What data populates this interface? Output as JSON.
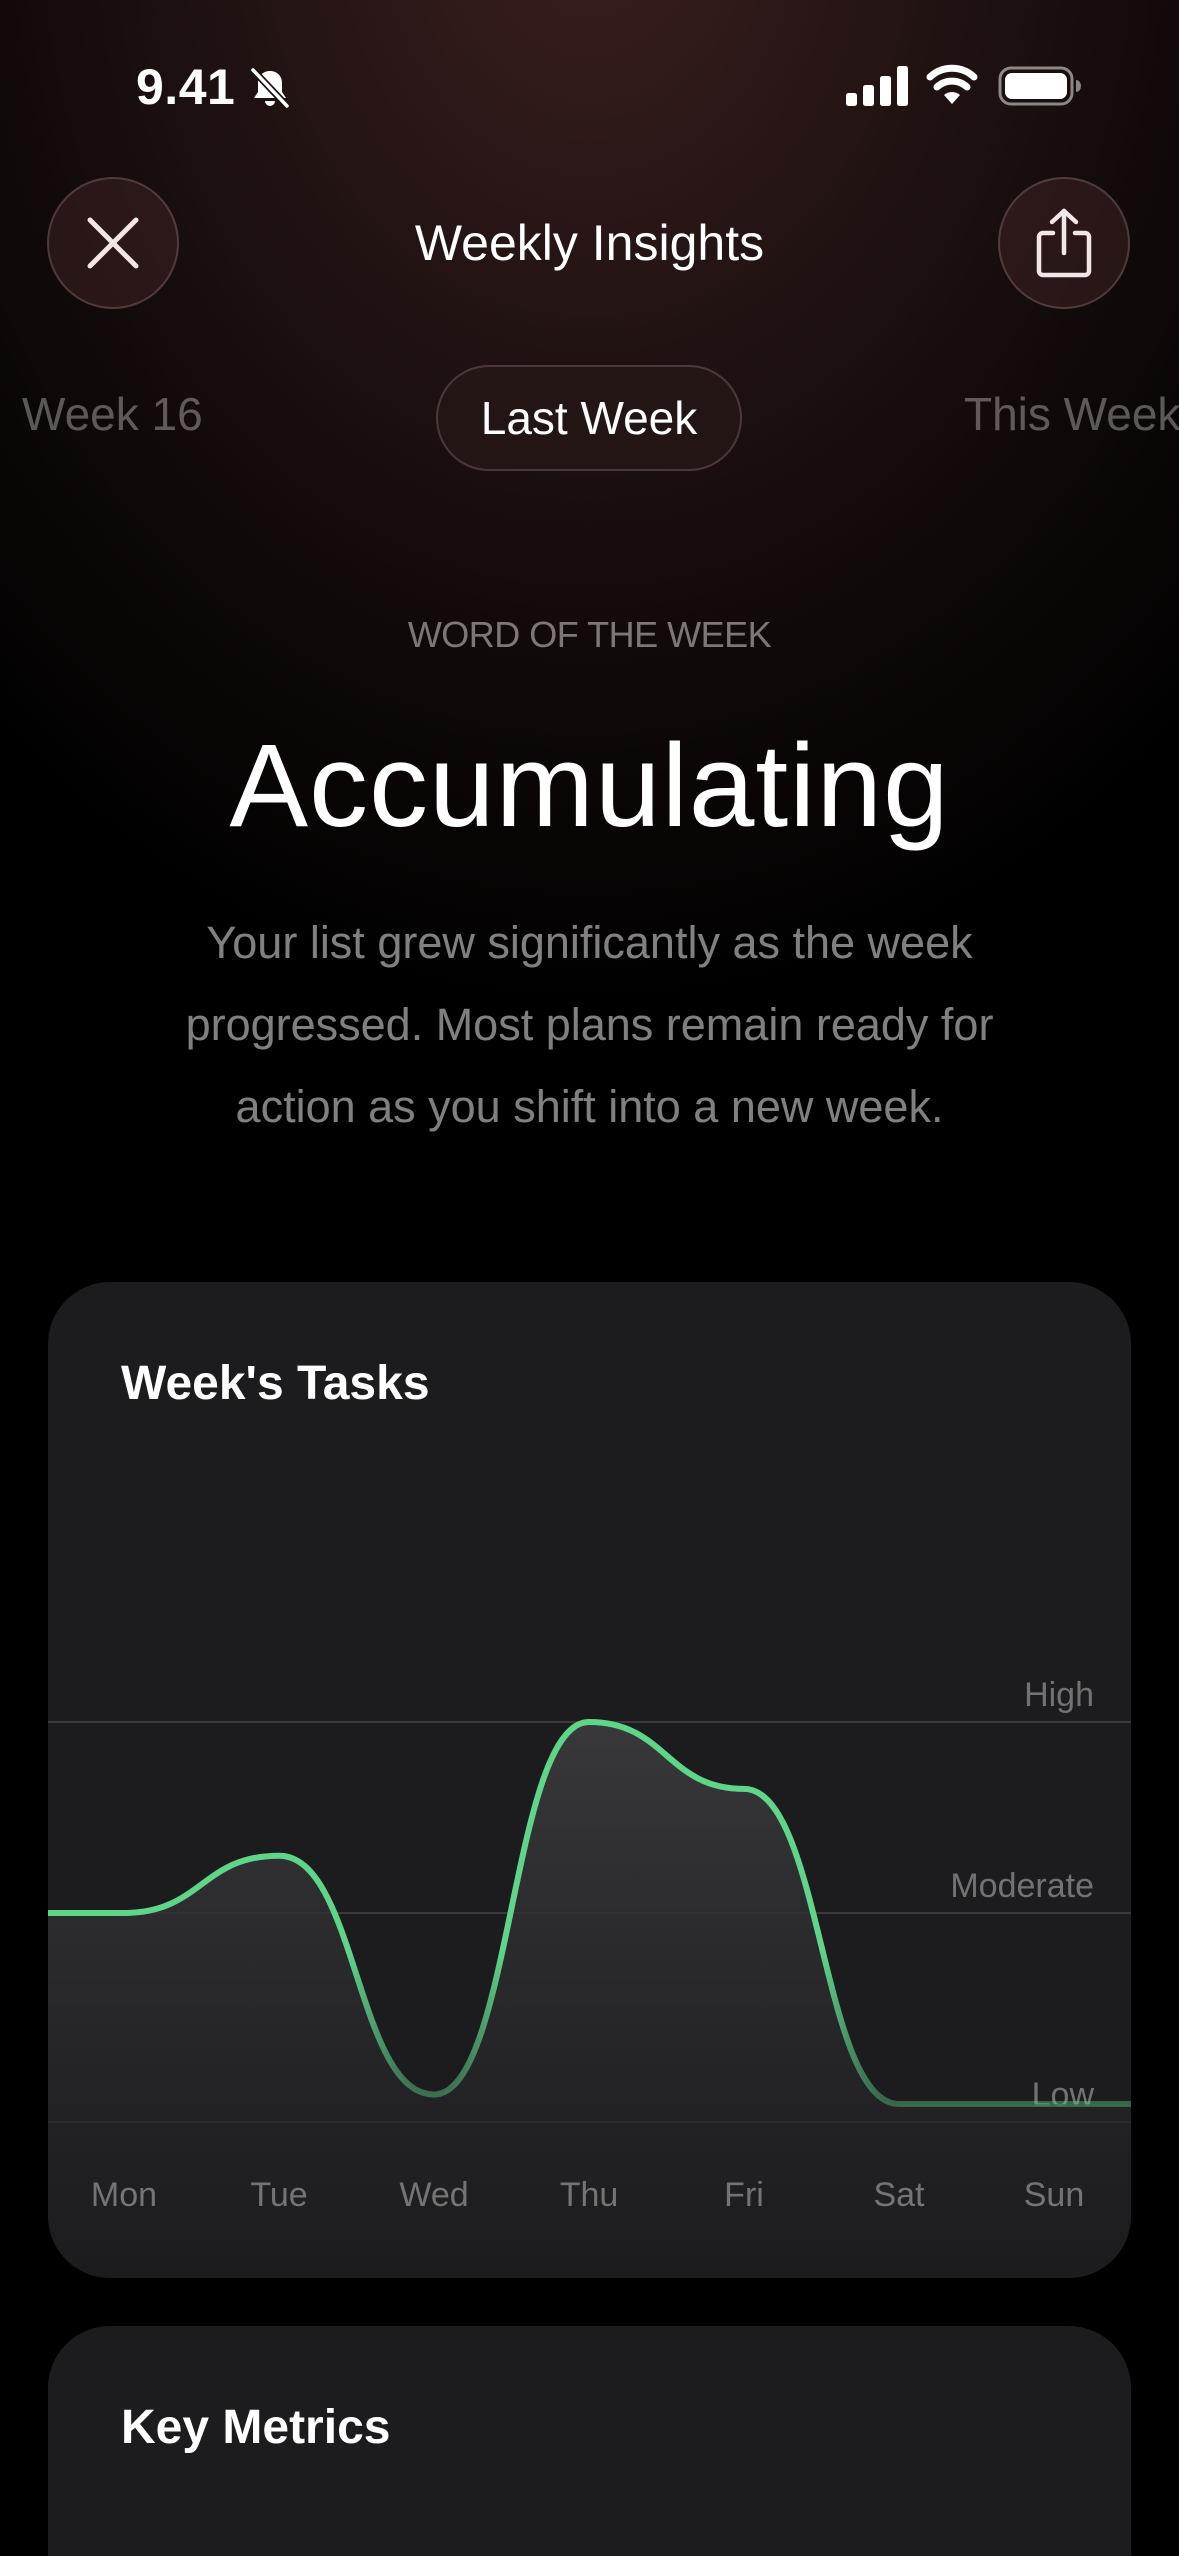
{
  "status_bar": {
    "time": "9.41",
    "icons": [
      "bell-slash-icon",
      "cellular-signal-icon",
      "wifi-icon",
      "battery-icon"
    ]
  },
  "header": {
    "title": "Weekly Insights",
    "close_icon": "close-icon",
    "share_icon": "share-icon"
  },
  "week_selector": {
    "previous": "Week 16",
    "current": "Last Week",
    "next": "This Week"
  },
  "word_of_week": {
    "label": "WORD OF THE WEEK",
    "word": "Accumulating",
    "description": "Your list grew significantly as the week progressed. Most plans remain ready for action as you shift into a new week."
  },
  "tasks_card": {
    "title": "Week's Tasks"
  },
  "chart_data": {
    "type": "area",
    "title": "Week's Tasks",
    "categories": [
      "Mon",
      "Tue",
      "Wed",
      "Thu",
      "Fri",
      "Sat",
      "Sun"
    ],
    "y_levels": [
      "Low",
      "Moderate",
      "High"
    ],
    "y_level_values": [
      0,
      1,
      2
    ],
    "series": [
      {
        "values": [
          1.0,
          1.3,
          0.05,
          2.0,
          1.65,
          0.0,
          0.0
        ]
      }
    ],
    "ylim": [
      0,
      2
    ],
    "grid": true,
    "line_color": "#5fd58a"
  },
  "metrics_card": {
    "title": "Key Metrics"
  },
  "colors": {
    "accent_green": "#5fd58a",
    "card_bg": "#1c1c1e"
  }
}
